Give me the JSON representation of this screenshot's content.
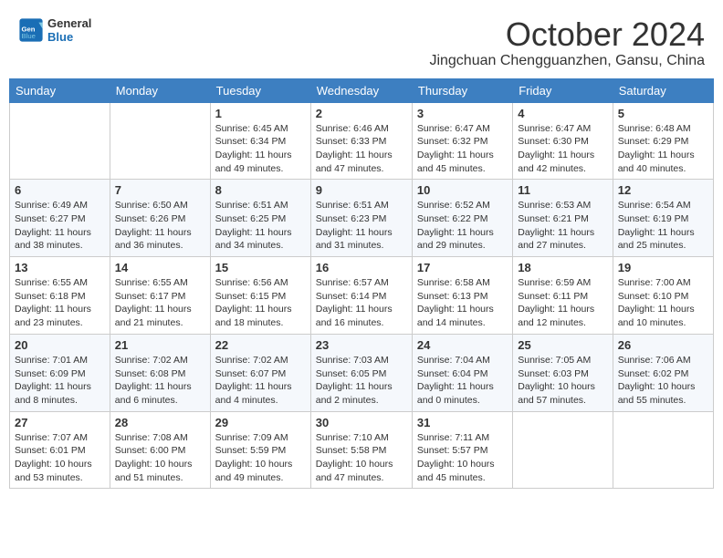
{
  "header": {
    "logo_line1": "General",
    "logo_line2": "Blue",
    "month": "October 2024",
    "location": "Jingchuan Chengguanzhen, Gansu, China"
  },
  "days_of_week": [
    "Sunday",
    "Monday",
    "Tuesday",
    "Wednesday",
    "Thursday",
    "Friday",
    "Saturday"
  ],
  "weeks": [
    [
      {
        "day": "",
        "sunrise": "",
        "sunset": "",
        "daylight": ""
      },
      {
        "day": "",
        "sunrise": "",
        "sunset": "",
        "daylight": ""
      },
      {
        "day": "1",
        "sunrise": "Sunrise: 6:45 AM",
        "sunset": "Sunset: 6:34 PM",
        "daylight": "Daylight: 11 hours and 49 minutes."
      },
      {
        "day": "2",
        "sunrise": "Sunrise: 6:46 AM",
        "sunset": "Sunset: 6:33 PM",
        "daylight": "Daylight: 11 hours and 47 minutes."
      },
      {
        "day": "3",
        "sunrise": "Sunrise: 6:47 AM",
        "sunset": "Sunset: 6:32 PM",
        "daylight": "Daylight: 11 hours and 45 minutes."
      },
      {
        "day": "4",
        "sunrise": "Sunrise: 6:47 AM",
        "sunset": "Sunset: 6:30 PM",
        "daylight": "Daylight: 11 hours and 42 minutes."
      },
      {
        "day": "5",
        "sunrise": "Sunrise: 6:48 AM",
        "sunset": "Sunset: 6:29 PM",
        "daylight": "Daylight: 11 hours and 40 minutes."
      }
    ],
    [
      {
        "day": "6",
        "sunrise": "Sunrise: 6:49 AM",
        "sunset": "Sunset: 6:27 PM",
        "daylight": "Daylight: 11 hours and 38 minutes."
      },
      {
        "day": "7",
        "sunrise": "Sunrise: 6:50 AM",
        "sunset": "Sunset: 6:26 PM",
        "daylight": "Daylight: 11 hours and 36 minutes."
      },
      {
        "day": "8",
        "sunrise": "Sunrise: 6:51 AM",
        "sunset": "Sunset: 6:25 PM",
        "daylight": "Daylight: 11 hours and 34 minutes."
      },
      {
        "day": "9",
        "sunrise": "Sunrise: 6:51 AM",
        "sunset": "Sunset: 6:23 PM",
        "daylight": "Daylight: 11 hours and 31 minutes."
      },
      {
        "day": "10",
        "sunrise": "Sunrise: 6:52 AM",
        "sunset": "Sunset: 6:22 PM",
        "daylight": "Daylight: 11 hours and 29 minutes."
      },
      {
        "day": "11",
        "sunrise": "Sunrise: 6:53 AM",
        "sunset": "Sunset: 6:21 PM",
        "daylight": "Daylight: 11 hours and 27 minutes."
      },
      {
        "day": "12",
        "sunrise": "Sunrise: 6:54 AM",
        "sunset": "Sunset: 6:19 PM",
        "daylight": "Daylight: 11 hours and 25 minutes."
      }
    ],
    [
      {
        "day": "13",
        "sunrise": "Sunrise: 6:55 AM",
        "sunset": "Sunset: 6:18 PM",
        "daylight": "Daylight: 11 hours and 23 minutes."
      },
      {
        "day": "14",
        "sunrise": "Sunrise: 6:55 AM",
        "sunset": "Sunset: 6:17 PM",
        "daylight": "Daylight: 11 hours and 21 minutes."
      },
      {
        "day": "15",
        "sunrise": "Sunrise: 6:56 AM",
        "sunset": "Sunset: 6:15 PM",
        "daylight": "Daylight: 11 hours and 18 minutes."
      },
      {
        "day": "16",
        "sunrise": "Sunrise: 6:57 AM",
        "sunset": "Sunset: 6:14 PM",
        "daylight": "Daylight: 11 hours and 16 minutes."
      },
      {
        "day": "17",
        "sunrise": "Sunrise: 6:58 AM",
        "sunset": "Sunset: 6:13 PM",
        "daylight": "Daylight: 11 hours and 14 minutes."
      },
      {
        "day": "18",
        "sunrise": "Sunrise: 6:59 AM",
        "sunset": "Sunset: 6:11 PM",
        "daylight": "Daylight: 11 hours and 12 minutes."
      },
      {
        "day": "19",
        "sunrise": "Sunrise: 7:00 AM",
        "sunset": "Sunset: 6:10 PM",
        "daylight": "Daylight: 11 hours and 10 minutes."
      }
    ],
    [
      {
        "day": "20",
        "sunrise": "Sunrise: 7:01 AM",
        "sunset": "Sunset: 6:09 PM",
        "daylight": "Daylight: 11 hours and 8 minutes."
      },
      {
        "day": "21",
        "sunrise": "Sunrise: 7:02 AM",
        "sunset": "Sunset: 6:08 PM",
        "daylight": "Daylight: 11 hours and 6 minutes."
      },
      {
        "day": "22",
        "sunrise": "Sunrise: 7:02 AM",
        "sunset": "Sunset: 6:07 PM",
        "daylight": "Daylight: 11 hours and 4 minutes."
      },
      {
        "day": "23",
        "sunrise": "Sunrise: 7:03 AM",
        "sunset": "Sunset: 6:05 PM",
        "daylight": "Daylight: 11 hours and 2 minutes."
      },
      {
        "day": "24",
        "sunrise": "Sunrise: 7:04 AM",
        "sunset": "Sunset: 6:04 PM",
        "daylight": "Daylight: 11 hours and 0 minutes."
      },
      {
        "day": "25",
        "sunrise": "Sunrise: 7:05 AM",
        "sunset": "Sunset: 6:03 PM",
        "daylight": "Daylight: 10 hours and 57 minutes."
      },
      {
        "day": "26",
        "sunrise": "Sunrise: 7:06 AM",
        "sunset": "Sunset: 6:02 PM",
        "daylight": "Daylight: 10 hours and 55 minutes."
      }
    ],
    [
      {
        "day": "27",
        "sunrise": "Sunrise: 7:07 AM",
        "sunset": "Sunset: 6:01 PM",
        "daylight": "Daylight: 10 hours and 53 minutes."
      },
      {
        "day": "28",
        "sunrise": "Sunrise: 7:08 AM",
        "sunset": "Sunset: 6:00 PM",
        "daylight": "Daylight: 10 hours and 51 minutes."
      },
      {
        "day": "29",
        "sunrise": "Sunrise: 7:09 AM",
        "sunset": "Sunset: 5:59 PM",
        "daylight": "Daylight: 10 hours and 49 minutes."
      },
      {
        "day": "30",
        "sunrise": "Sunrise: 7:10 AM",
        "sunset": "Sunset: 5:58 PM",
        "daylight": "Daylight: 10 hours and 47 minutes."
      },
      {
        "day": "31",
        "sunrise": "Sunrise: 7:11 AM",
        "sunset": "Sunset: 5:57 PM",
        "daylight": "Daylight: 10 hours and 45 minutes."
      },
      {
        "day": "",
        "sunrise": "",
        "sunset": "",
        "daylight": ""
      },
      {
        "day": "",
        "sunrise": "",
        "sunset": "",
        "daylight": ""
      }
    ]
  ]
}
